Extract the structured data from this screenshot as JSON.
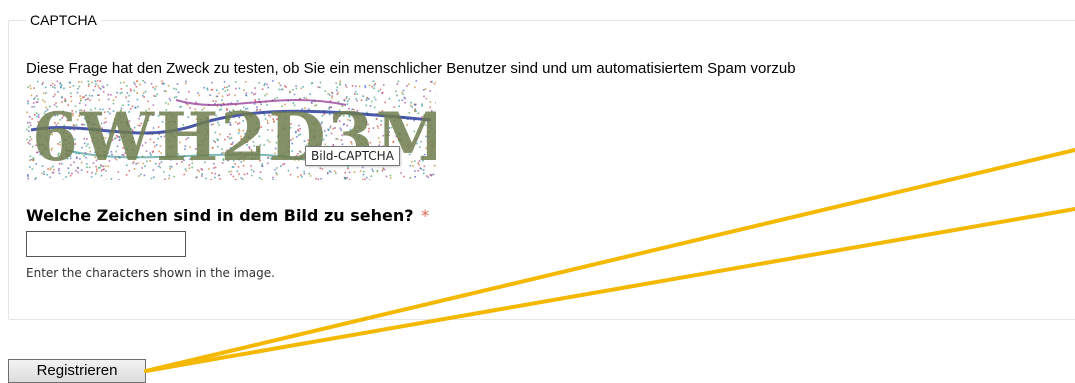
{
  "captcha": {
    "legend": "CAPTCHA",
    "description": "Diese Frage hat den Zweck zu testen, ob Sie ein menschlicher Benutzer sind und um automatisiertem Spam vorzub",
    "image_tooltip": "Bild-CAPTCHA",
    "image_alt": "6WH2D3M"
  },
  "field": {
    "label": "Welche Zeichen sind in dem Bild zu sehen?",
    "required_mark": "*",
    "value": "",
    "help": "Enter the characters shown in the image."
  },
  "actions": {
    "submit_label": "Registrieren"
  },
  "colors": {
    "annotation_line": "#f5b800",
    "required_mark": "#e06050"
  }
}
